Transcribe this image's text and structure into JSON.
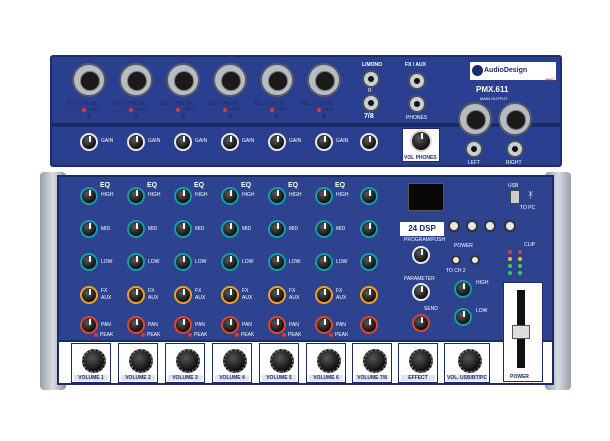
{
  "brand": {
    "name": "AudioDesign",
    "line": "PRO",
    "model": "PMX.611"
  },
  "channels": [
    {
      "num": "1",
      "vol": "VOLUME 1"
    },
    {
      "num": "2",
      "vol": "VOLUME 2"
    },
    {
      "num": "3",
      "vol": "VOLUME 3"
    },
    {
      "num": "4",
      "vol": "VOLUME 4"
    },
    {
      "num": "5",
      "vol": "VOLUME 5"
    },
    {
      "num": "6",
      "vol": "VOLUME 6"
    }
  ],
  "labels": {
    "mic_line_in": "MIC / LINE IN",
    "phantom": "+48V",
    "gain": "GAIN",
    "eq": "EQ",
    "high": "HIGH",
    "mid": "MID",
    "low": "LOW",
    "fx": "FX",
    "aux": "AUX",
    "pan": "PAN",
    "peak": "PEAK",
    "l_mono": "L/MONO",
    "r": "R",
    "ch78": "7/8",
    "fx_aux": "FX / AUX",
    "phones": "PHONES",
    "main_output": "MAIN OUTPUT",
    "left": "LEFT",
    "right": "RIGHT",
    "vol_phones": "VOL PHONES",
    "dsp": "24 DSP",
    "effects": "EFFECTS",
    "program": "PROGRAM/PUSH",
    "power": "POWER",
    "parameter": "PARAMETER",
    "send": "SEND",
    "usb": "USB",
    "to_pc": "TO PC",
    "to_ch2": "TO CH 2",
    "clip": "CLIP",
    "vol_78": "VOLUME 7/8",
    "effect": "EFFECT",
    "vol_usb": "VOL. USB/BT/PC",
    "power_bottom": "POWER",
    "min": "MIN",
    "max": "MAX"
  },
  "colors": {
    "panel": "#2a3f8f",
    "accent_teal": "#0e9fa8",
    "accent_orange": "#f2a023",
    "accent_red": "#e2452a"
  }
}
